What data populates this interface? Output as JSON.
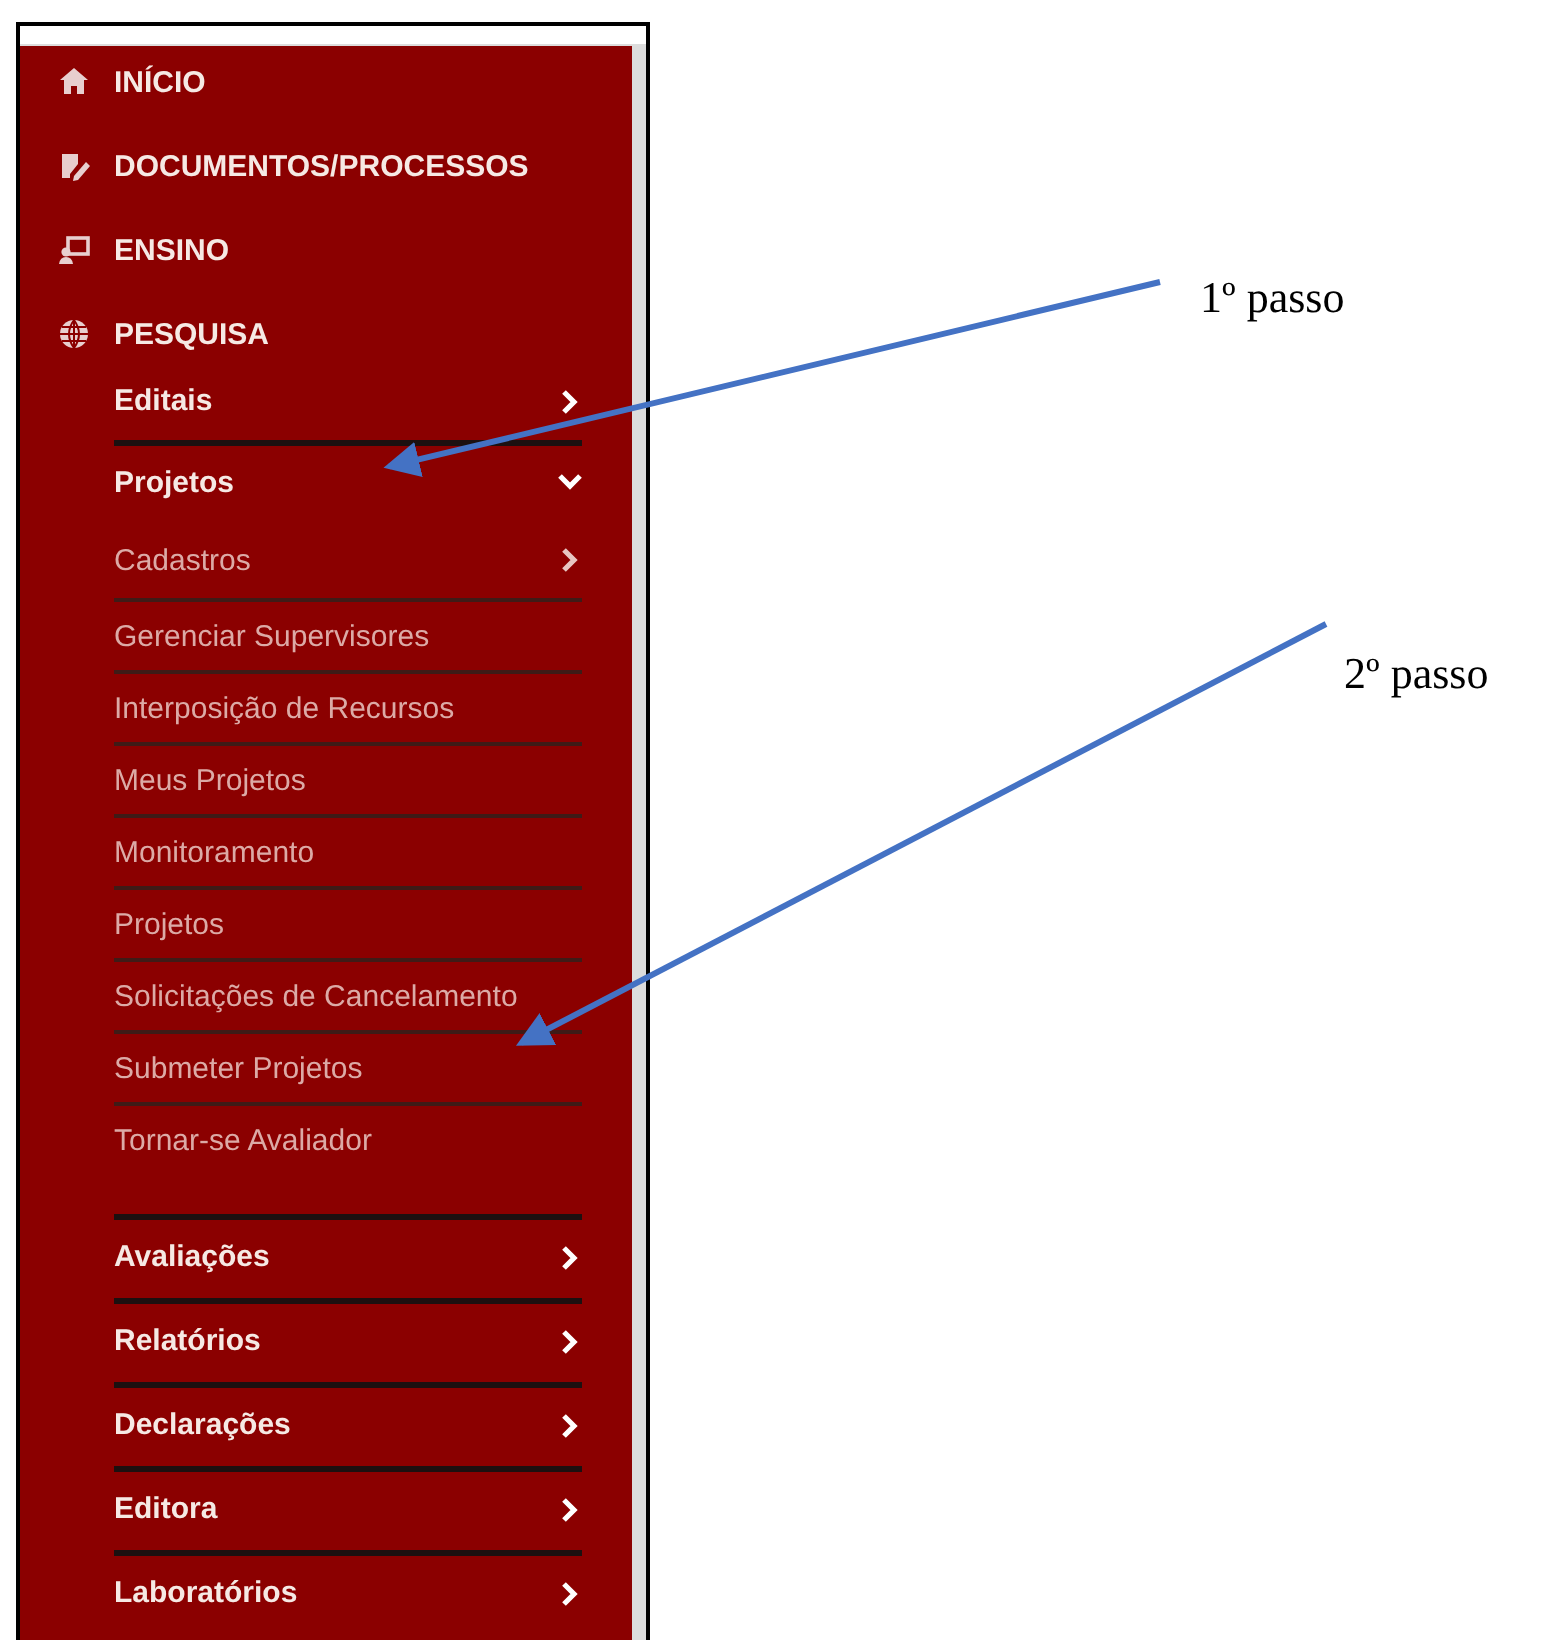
{
  "menu": {
    "items": [
      {
        "label": "INÍCIO"
      },
      {
        "label": "DOCUMENTOS/PROCESSOS"
      },
      {
        "label": "ENSINO"
      },
      {
        "label": "PESQUISA",
        "children": [
          {
            "label": "Editais",
            "expanded": false
          },
          {
            "label": "Projetos",
            "expanded": true,
            "children": [
              {
                "label": "Cadastros",
                "kind": "submenu"
              },
              {
                "label": "Gerenciar Supervisores",
                "kind": "link"
              },
              {
                "label": "Interposição de Recursos",
                "kind": "link"
              },
              {
                "label": "Meus Projetos",
                "kind": "link"
              },
              {
                "label": "Monitoramento",
                "kind": "link"
              },
              {
                "label": "Projetos",
                "kind": "link"
              },
              {
                "label": "Solicitações de Cancelamento",
                "kind": "link"
              },
              {
                "label": "Submeter Projetos",
                "kind": "link"
              },
              {
                "label": "Tornar-se Avaliador",
                "kind": "link"
              }
            ]
          },
          {
            "label": "Avaliações",
            "expanded": false
          },
          {
            "label": "Relatórios",
            "expanded": false
          },
          {
            "label": "Declarações",
            "expanded": false
          },
          {
            "label": "Editora",
            "expanded": false
          },
          {
            "label": "Laboratórios",
            "expanded": false
          }
        ]
      }
    ]
  },
  "annotations": [
    {
      "label": "1º passo"
    },
    {
      "label": "2º passo"
    }
  ]
}
